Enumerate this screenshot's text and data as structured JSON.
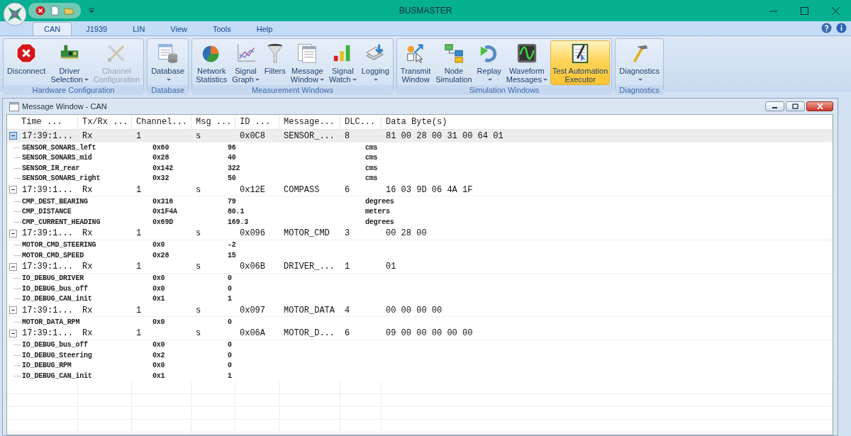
{
  "window": {
    "title": "BUSMASTER"
  },
  "tabs": [
    {
      "label": "CAN",
      "selected": true
    },
    {
      "label": "J1939",
      "selected": false
    },
    {
      "label": "LIN",
      "selected": false
    },
    {
      "label": "View",
      "selected": false
    },
    {
      "label": "Tools",
      "selected": false
    },
    {
      "label": "Help",
      "selected": false
    }
  ],
  "ribbon_groups": [
    {
      "label": "Hardware Configuration",
      "buttons": [
        {
          "label": [
            "Disconnect"
          ],
          "dropdown": false,
          "disabled": false,
          "highlighted": false
        },
        {
          "label": [
            "Driver",
            "Selection"
          ],
          "dropdown": true,
          "disabled": false,
          "highlighted": false
        },
        {
          "label": [
            "Channel",
            "Configuration"
          ],
          "dropdown": false,
          "disabled": true,
          "highlighted": false
        }
      ]
    },
    {
      "label": "Database",
      "buttons": [
        {
          "label": [
            "Database"
          ],
          "dropdown": true,
          "disabled": false,
          "highlighted": false
        }
      ]
    },
    {
      "label": "Measurement Windows",
      "buttons": [
        {
          "label": [
            "Network",
            "Statistics"
          ],
          "dropdown": false,
          "disabled": false,
          "highlighted": false
        },
        {
          "label": [
            "Signal",
            "Graph"
          ],
          "dropdown": true,
          "disabled": false,
          "highlighted": false
        },
        {
          "label": [
            "Filters"
          ],
          "dropdown": false,
          "disabled": false,
          "highlighted": false
        },
        {
          "label": [
            "Message",
            "Window"
          ],
          "dropdown": true,
          "disabled": false,
          "highlighted": false
        },
        {
          "label": [
            "Signal",
            "Watch"
          ],
          "dropdown": true,
          "disabled": false,
          "highlighted": false
        },
        {
          "label": [
            "Logging"
          ],
          "dropdown": true,
          "disabled": false,
          "highlighted": false
        }
      ]
    },
    {
      "label": "Simulation Windows",
      "buttons": [
        {
          "label": [
            "Transmit",
            "Window"
          ],
          "dropdown": false,
          "disabled": false,
          "highlighted": false
        },
        {
          "label": [
            "Node",
            "Simulation"
          ],
          "dropdown": false,
          "disabled": false,
          "highlighted": false
        },
        {
          "label": [
            "Replay"
          ],
          "dropdown": true,
          "disabled": false,
          "highlighted": false
        },
        {
          "label": [
            "Waveform",
            "Messages"
          ],
          "dropdown": true,
          "disabled": false,
          "highlighted": false
        },
        {
          "label": [
            "Test Automation",
            "Executor"
          ],
          "dropdown": false,
          "disabled": false,
          "highlighted": true
        }
      ]
    },
    {
      "label": "Diagnostics",
      "buttons": [
        {
          "label": [
            "Diagnostics"
          ],
          "dropdown": true,
          "disabled": false,
          "highlighted": false
        }
      ]
    }
  ],
  "message_window": {
    "title": "Message Window - CAN",
    "columns": [
      "Time ...",
      "Tx/Rx ...",
      "Channel...",
      "Msg ...",
      "ID ...",
      "Message...",
      "DLC...",
      "Data Byte(s)"
    ],
    "messages": [
      {
        "time": "17:39:1...",
        "txrx": "Rx",
        "channel": "1",
        "msg": "s",
        "id": "0x0C8",
        "message": "SENSOR_...",
        "dlc": "8",
        "data": "81 00 28 00 31 00 64 01",
        "selected": true,
        "expanded": true,
        "signals": [
          {
            "name": "SENSOR_SONARS_left",
            "raw": "0x60",
            "physical": "96",
            "unit": "cms"
          },
          {
            "name": "SENSOR_SONARS_mid",
            "raw": "0x28",
            "physical": "40",
            "unit": "cms"
          },
          {
            "name": "SENSOR_IR_rear",
            "raw": "0x142",
            "physical": "322",
            "unit": "cms"
          },
          {
            "name": "SENSOR_SONARS_right",
            "raw": "0x32",
            "physical": "50",
            "unit": "cms"
          }
        ]
      },
      {
        "time": "17:39:1...",
        "txrx": "Rx",
        "channel": "1",
        "msg": "s",
        "id": "0x12E",
        "message": "COMPASS",
        "dlc": "6",
        "data": "16 03 9D 06 4A 1F",
        "selected": false,
        "expanded": true,
        "signals": [
          {
            "name": "CMP_DEST_BEARING",
            "raw": "0x316",
            "physical": "79",
            "unit": "degrees"
          },
          {
            "name": "CMP_DISTANCE",
            "raw": "0x1F4A",
            "physical": "80.1",
            "unit": "meters"
          },
          {
            "name": "CMP_CURRENT_HEADING",
            "raw": "0x69D",
            "physical": "169.3",
            "unit": "degrees"
          }
        ]
      },
      {
        "time": "17:39:1...",
        "txrx": "Rx",
        "channel": "1",
        "msg": "s",
        "id": "0x096",
        "message": "MOTOR_CMD",
        "dlc": "3",
        "data": "00 28 00",
        "selected": false,
        "expanded": true,
        "signals": [
          {
            "name": "MOTOR_CMD_STEERING",
            "raw": "0x0",
            "physical": "-2"
          },
          {
            "name": "MOTOR_CMD_SPEED",
            "raw": "0x28",
            "physical": "15"
          }
        ]
      },
      {
        "time": "17:39:1...",
        "txrx": "Rx",
        "channel": "1",
        "msg": "s",
        "id": "0x06B",
        "message": "DRIVER_...",
        "dlc": "1",
        "data": "01",
        "selected": false,
        "expanded": true,
        "signals": [
          {
            "name": "IO_DEBUG_DRIVER",
            "raw": "0x0",
            "physical": "0"
          },
          {
            "name": "IO_DEBUG_bus_off",
            "raw": "0x0",
            "physical": "0"
          },
          {
            "name": "IO_DEBUG_CAN_init",
            "raw": "0x1",
            "physical": "1"
          }
        ]
      },
      {
        "time": "17:39:1...",
        "txrx": "Rx",
        "channel": "1",
        "msg": "s",
        "id": "0x097",
        "message": "MOTOR_DATA",
        "dlc": "4",
        "data": "00 00 00 00",
        "selected": false,
        "expanded": true,
        "signals": [
          {
            "name": "MOTOR_DATA_RPM",
            "raw": "0x0",
            "physical": "0"
          }
        ]
      },
      {
        "time": "17:39:1...",
        "txrx": "Rx",
        "channel": "1",
        "msg": "s",
        "id": "0x06A",
        "message": "MOTOR_D...",
        "dlc": "6",
        "data": "09 00 00 00 00 00",
        "selected": false,
        "expanded": true,
        "signals": [
          {
            "name": "IO_DEBUG_bus_off",
            "raw": "0x0",
            "physical": "0"
          },
          {
            "name": "IO_DEBUG_Steering",
            "raw": "0x2",
            "physical": "0"
          },
          {
            "name": "IO_DEBUG_RPM",
            "raw": "0x0",
            "physical": "0"
          },
          {
            "name": "IO_DEBUG_CAN_init",
            "raw": "0x1",
            "physical": "1"
          }
        ]
      }
    ]
  }
}
